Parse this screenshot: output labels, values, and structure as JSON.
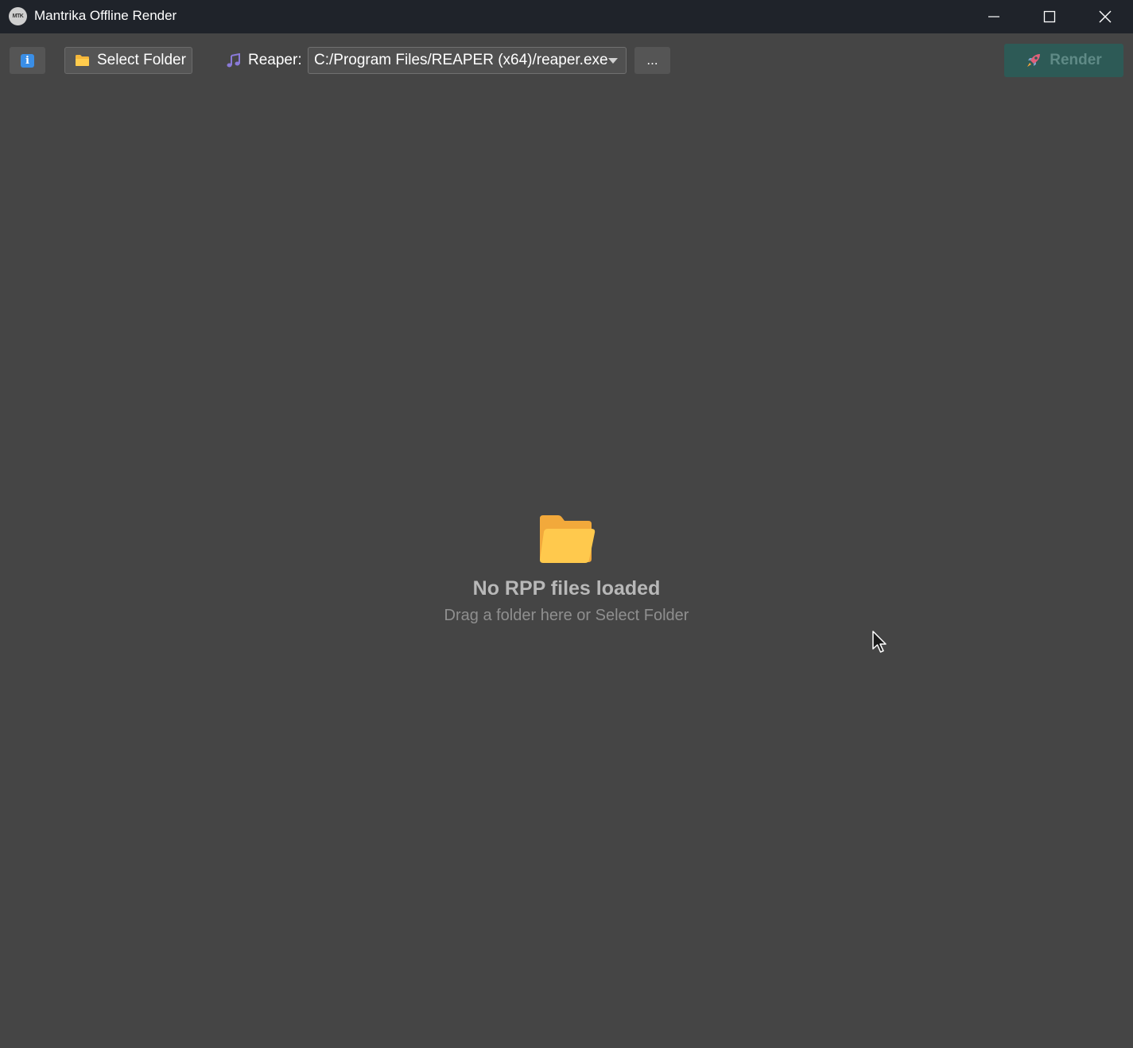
{
  "window": {
    "title": "Mantrika Offline Render",
    "logo_text": "MTK"
  },
  "toolbar": {
    "info_label": "i",
    "select_folder_label": "Select Folder",
    "reaper_label": "Reaper:",
    "reaper_path": "C:/Program Files/REAPER (x64)/reaper.exe",
    "browse_label": "...",
    "render_label": "Render"
  },
  "empty_state": {
    "title": "No RPP files loaded",
    "subtitle": "Drag a folder here or Select Folder"
  },
  "icons": {
    "info": "info-icon",
    "folder": "folder-icon",
    "music": "music-note-icon",
    "rocket": "rocket-icon",
    "minimize": "minimize-icon",
    "maximize": "maximize-icon",
    "close": "close-icon"
  },
  "colors": {
    "background": "#454545",
    "titlebar": "#1f232a",
    "render_accent": "#2d5a56",
    "folder": "#f9c23c",
    "info_accent": "#3a8ee6"
  }
}
